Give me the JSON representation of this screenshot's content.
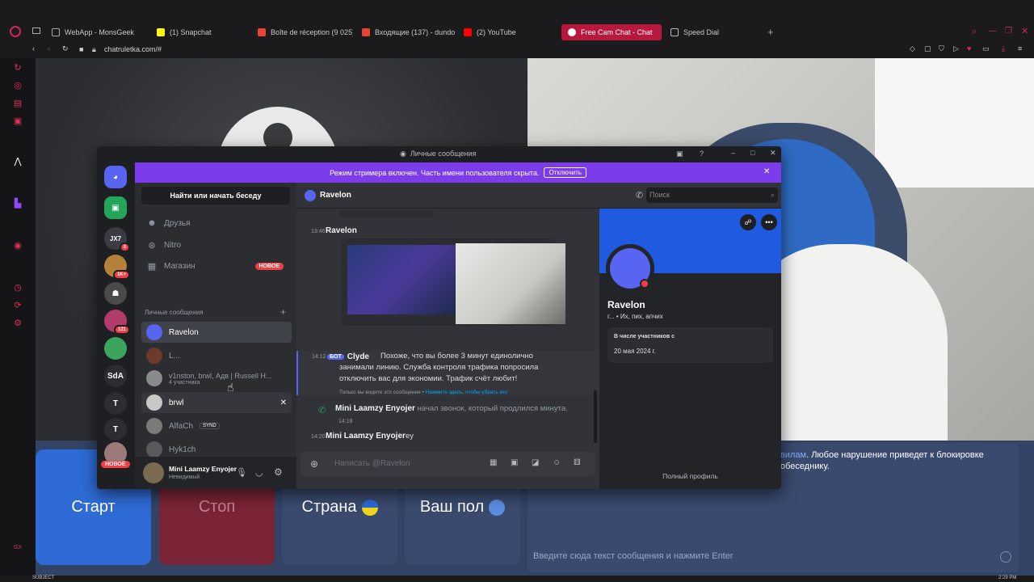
{
  "browser": {
    "tabs": [
      {
        "label": "WebApp - MonsGeek",
        "color": "#5c5c5c"
      },
      {
        "label": "(1) Snapchat",
        "color": "#fffc00"
      },
      {
        "label": "Boîte de réception (9 025)",
        "color": "#e84335"
      },
      {
        "label": "Входящие (137) - dundo",
        "color": "#e84335"
      },
      {
        "label": "(2) YouTube",
        "color": "#ff0000"
      },
      {
        "label": "Free Cam Chat - Chat",
        "color": "#ffffff"
      },
      {
        "label": "Speed Dial",
        "color": "#bbbbbb"
      }
    ],
    "url": "chatruletka.com/#",
    "accent": "#b8183d"
  },
  "page": {
    "buttons": {
      "start": "Старт",
      "stop": "Стоп",
      "country": "Страна",
      "gender": "Ваш пол"
    },
    "rules_link": "вилам",
    "rules_text": ". Любое нарушение приведет к блокировке",
    "rules_text2": "обеседнику.",
    "chat_placeholder": "Введите сюда текст сообщения и нажмите Enter",
    "taskbar_left": "SUBJECT",
    "taskbar_time": "2:29 PM"
  },
  "discord": {
    "window_title": "Личные сообщения",
    "banner_text": "Режим стримера включен. Часть имени пользователя скрыта.",
    "banner_button": "Отключить",
    "guilds": [
      {
        "label": "JX7",
        "badge": "3",
        "color": "#3a3c44"
      },
      {
        "label": "",
        "badge": "1K+",
        "color": "#b5813a"
      },
      {
        "label": "",
        "badge": "",
        "color": "#4a4a4a"
      },
      {
        "label": "",
        "badge": "121",
        "color": "#b13b6a"
      },
      {
        "label": "",
        "badge": "",
        "color": "#3ba55d"
      },
      {
        "label": "SdA",
        "badge": "",
        "color": "#2b2d31"
      },
      {
        "label": "T",
        "badge": "",
        "color": "#2b2d31"
      },
      {
        "label": "T",
        "badge": "",
        "color": "#2b2d31"
      }
    ],
    "guild_new_badge": "НОВОЕ",
    "search_label": "Найти или начать беседу",
    "nav": {
      "friends": "Друзья",
      "nitro": "Nitro",
      "shop": "Магазин",
      "shop_badge": "НОВОЕ"
    },
    "dm_section": "Личные сообщения",
    "dms": [
      {
        "name": "Ravelon",
        "sub": "",
        "color": "#5865f2"
      },
      {
        "name": "L...",
        "sub": "",
        "color": "#6a3a2a"
      },
      {
        "name": "v1nston, brwl, Адв | Russell H...",
        "sub": "4 участника",
        "color": "#8a8a8a"
      },
      {
        "name": "brwl",
        "sub": "",
        "color": "#c8c8c8"
      },
      {
        "name": "AlfaCh",
        "sub": "",
        "tag": "SYND",
        "color": "#7a7a7a"
      },
      {
        "name": "Hyk1ch",
        "sub": "",
        "color": "#5a5a5a"
      }
    ],
    "user": {
      "name": "Mini Laamzy Enyojer",
      "status": "Невидимый"
    },
    "header_name": "Ravelon",
    "search_placeholder": "Поиск",
    "messages": {
      "m1_time": "13:46",
      "m1_author": "Ravelon",
      "m2_time": "14:12",
      "m2_bot_tag": "БОТ",
      "m2_author": "Clyde",
      "m2_text": "Похоже, что вы более 3 минут единолично занимали линию. Служба контроля трафика попросила отключить вас для экономии. Трафик счёт любит!",
      "m2_note": "Только вы видите это сообщение •",
      "m2_note_link": "Нажмите здесь, чтобы убрать его",
      "call_author": "Mini Laamzy Enyojer",
      "call_text": "начал звонок, который продлился минута.",
      "call_time": "14:18",
      "m3_time": "14:20",
      "m3_author": "Mini Laamzy Enyojer",
      "m3_text": "ey"
    },
    "input_placeholder": "Написать @Ravelon",
    "profile": {
      "name": "Ravelon",
      "tags": "г... • Их, пих, апчих",
      "member_since_label": "В числе участников с",
      "member_since": "20 мая 2024 г.",
      "full_profile": "Полный профиль",
      "banner_color": "#1f5ae0"
    }
  }
}
